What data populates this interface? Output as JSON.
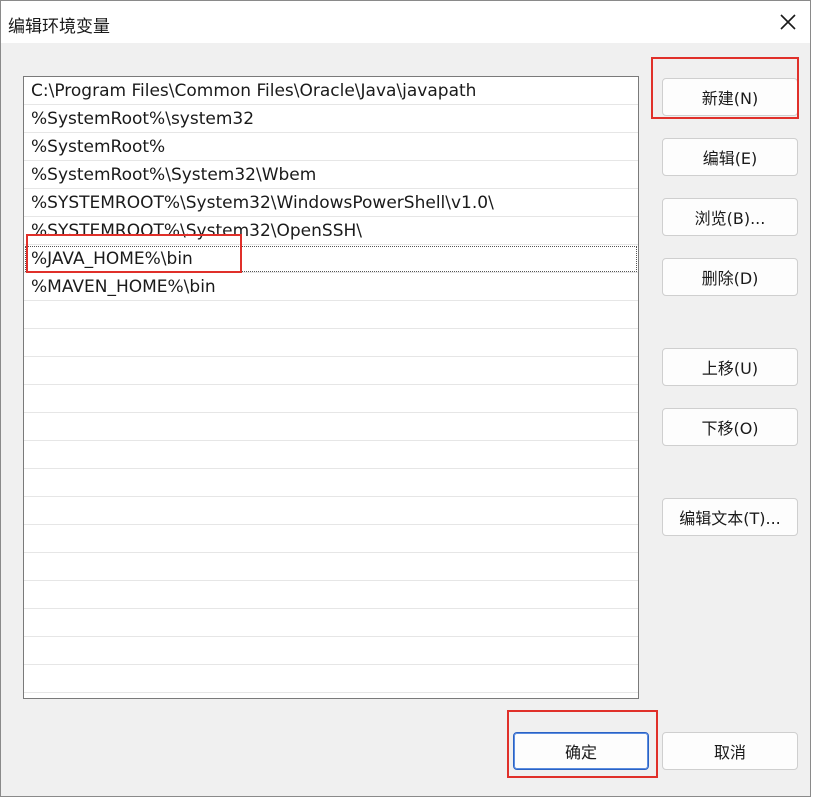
{
  "window": {
    "title": "编辑环境变量",
    "close_glyph": "✕"
  },
  "paths": [
    "C:\\Program Files\\Common Files\\Oracle\\Java\\javapath",
    "%SystemRoot%\\system32",
    "%SystemRoot%",
    "%SystemRoot%\\System32\\Wbem",
    "%SYSTEMROOT%\\System32\\WindowsPowerShell\\v1.0\\",
    "%SYSTEMROOT%\\System32\\OpenSSH\\",
    "%JAVA_HOME%\\bin",
    "%MAVEN_HOME%\\bin"
  ],
  "selected_path_index": 6,
  "buttons": {
    "new": "新建(N)",
    "edit": "编辑(E)",
    "browse": "浏览(B)...",
    "delete": "删除(D)",
    "move_up": "上移(U)",
    "move_down": "下移(O)",
    "edit_text": "编辑文本(T)...",
    "ok": "确定",
    "cancel": "取消"
  },
  "colors": {
    "highlight_box": "#e0302a",
    "primary_border": "#2b62c4"
  }
}
